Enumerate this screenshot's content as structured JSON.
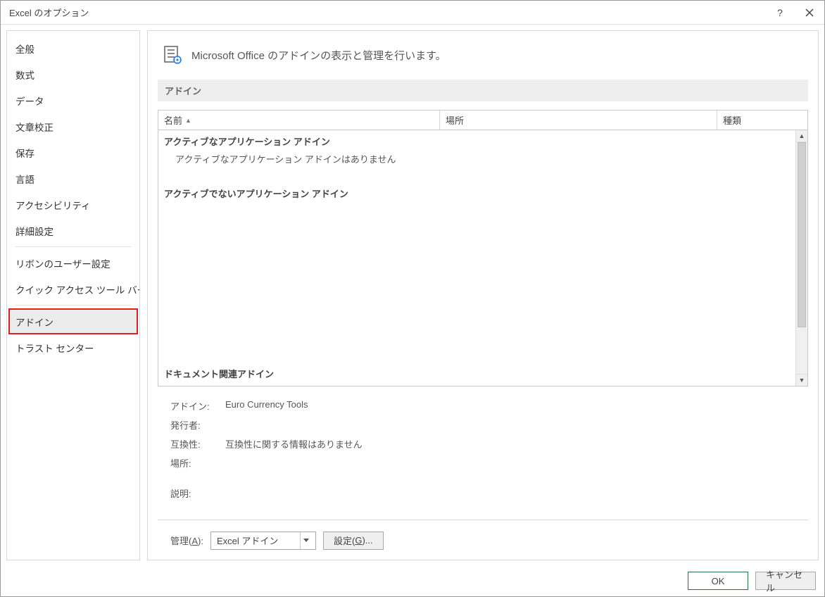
{
  "titlebar": {
    "title": "Excel のオプション"
  },
  "sidebar": {
    "items": [
      {
        "label": "全般"
      },
      {
        "label": "数式"
      },
      {
        "label": "データ"
      },
      {
        "label": "文章校正"
      },
      {
        "label": "保存"
      },
      {
        "label": "言語"
      },
      {
        "label": "アクセシビリティ"
      },
      {
        "label": "詳細設定"
      }
    ],
    "items2": [
      {
        "label": "リボンのユーザー設定"
      },
      {
        "label": "クイック アクセス ツール バー"
      }
    ],
    "items3": [
      {
        "label": "アドイン",
        "selected": true
      },
      {
        "label": "トラスト センター"
      }
    ]
  },
  "panel": {
    "heading": "Microsoft Office のアドインの表示と管理を行います。",
    "group_title": "アドイン",
    "columns": {
      "name": "名前",
      "location": "場所",
      "type": "種類"
    },
    "categories": {
      "active": "アクティブなアプリケーション アドイン",
      "active_empty": "アクティブなアプリケーション アドインはありません",
      "inactive": "アクティブでないアプリケーション アドイン",
      "docrelated": "ドキュメント関連アドイン"
    },
    "details": {
      "addin_label": "アドイン:",
      "addin_value": "Euro Currency Tools",
      "publisher_label": "発行者:",
      "publisher_value": "",
      "compat_label": "互換性:",
      "compat_value": "互換性に関する情報はありません",
      "location_label": "場所:",
      "location_value": "",
      "desc_label": "説明:",
      "desc_value": ""
    },
    "manage": {
      "label_prefix": "管理(",
      "label_mnemonic": "A",
      "label_suffix": "):",
      "combo_value": "Excel アドイン",
      "button_prefix": "設定(",
      "button_mnemonic": "G",
      "button_suffix": ")..."
    }
  },
  "footer": {
    "ok": "OK",
    "cancel": "キャンセル"
  }
}
